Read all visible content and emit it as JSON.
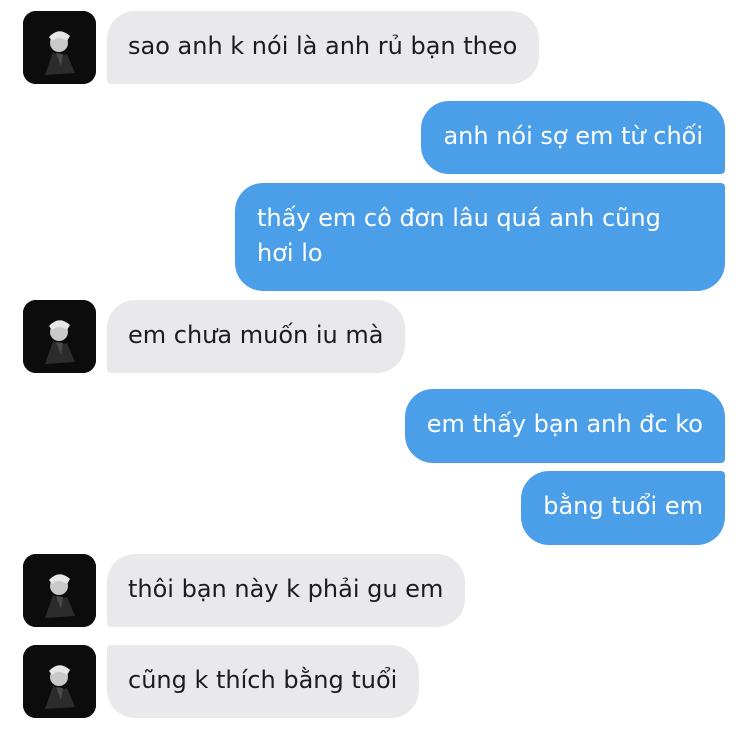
{
  "conversation": {
    "messages": [
      {
        "sender": "other",
        "text": "sao anh k nói là anh rủ bạn theo"
      },
      {
        "sender": "me",
        "text": "anh nói sợ em từ chối"
      },
      {
        "sender": "me",
        "text": "thấy em cô đơn lâu quá anh cũng hơi lo"
      },
      {
        "sender": "other",
        "text": "em chưa muốn iu mà"
      },
      {
        "sender": "me",
        "text": "em thấy bạn anh đc ko"
      },
      {
        "sender": "me",
        "text": "bằng tuổi em"
      },
      {
        "sender": "other",
        "text": "thôi bạn này k phải gu em"
      },
      {
        "sender": "other",
        "text": "cũng k thích bằng tuổi"
      }
    ]
  },
  "colors": {
    "outgoing_bubble": "#4b9ee8",
    "incoming_bubble": "#e9e9eb",
    "incoming_text": "#1c1c1e",
    "outgoing_text": "#ffffff"
  },
  "icons": {
    "avatar": "profile-photo-avatar"
  }
}
